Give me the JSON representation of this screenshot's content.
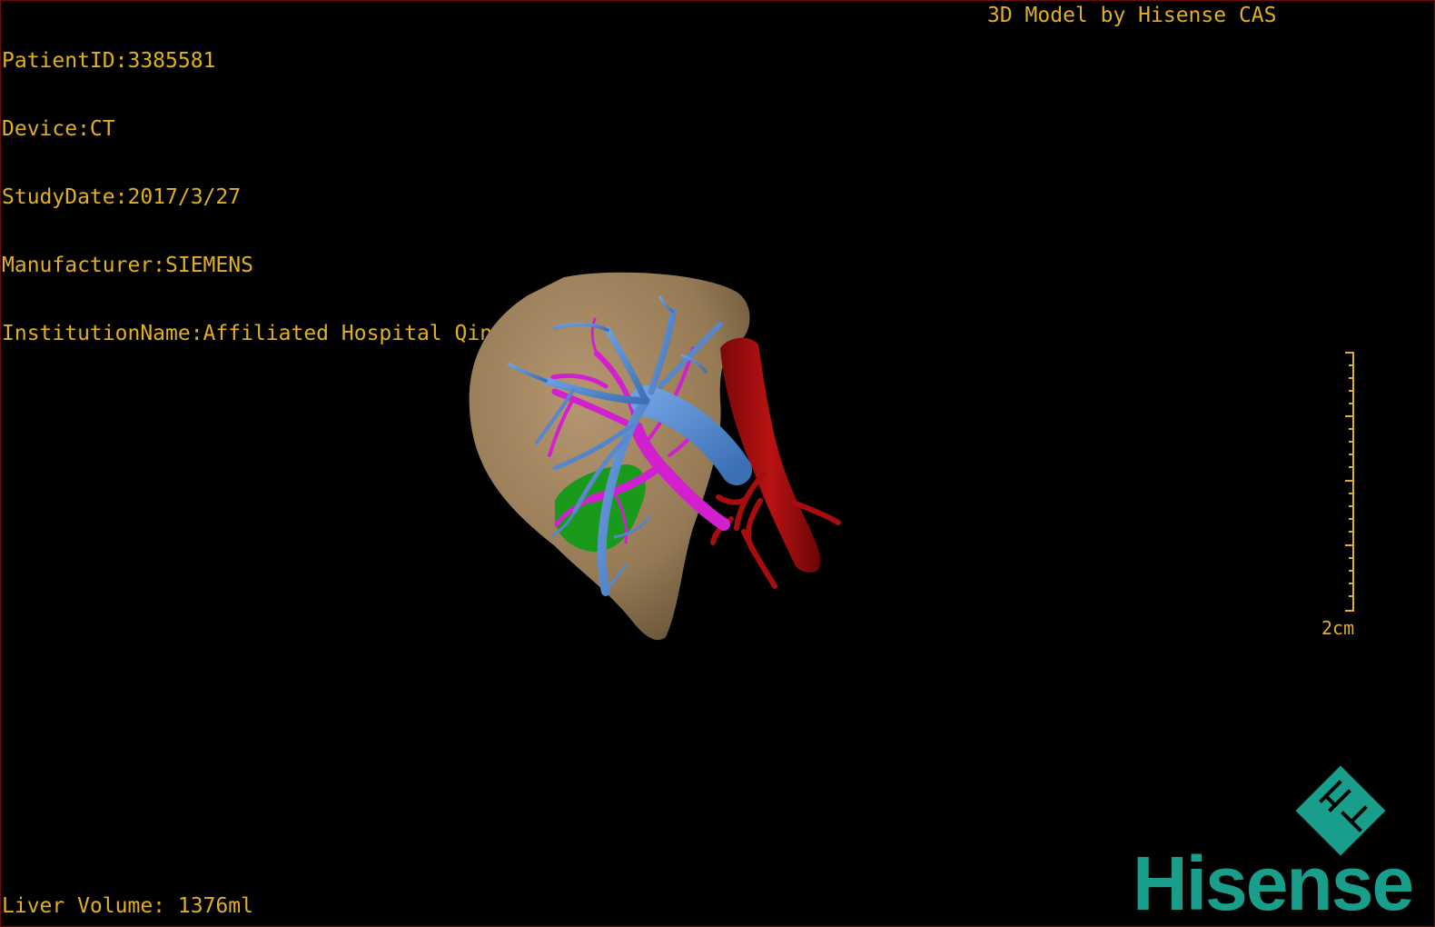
{
  "patient_info": {
    "patient_id": "PatientID:3385581",
    "device": "Device:CT",
    "study_date": "StudyDate:2017/3/27",
    "manufacturer": "Manufacturer:SIEMENS",
    "institution": "InstitutionName:Affiliated Hospital Qingdao University-C"
  },
  "credit": "3D Model by Hisense CAS",
  "liver_volume": "Liver Volume: 1376ml",
  "scale": {
    "label": "2cm"
  },
  "logo": {
    "wordmark": "Hisense",
    "mark_letters": "HT",
    "color": "#1a9e8c"
  },
  "model": {
    "structures": [
      {
        "name": "liver",
        "color": "#a38660"
      },
      {
        "name": "hepatic-vein",
        "color": "#5b8ed0"
      },
      {
        "name": "portal-vein",
        "color": "#d21fd0"
      },
      {
        "name": "gallbladder",
        "color": "#1a9a1a"
      },
      {
        "name": "inferior-vena-cava",
        "color": "#a80d0d"
      }
    ]
  },
  "colors": {
    "overlay_text": "#e0b020",
    "background": "#000000",
    "frame": "#6b0d0d"
  }
}
